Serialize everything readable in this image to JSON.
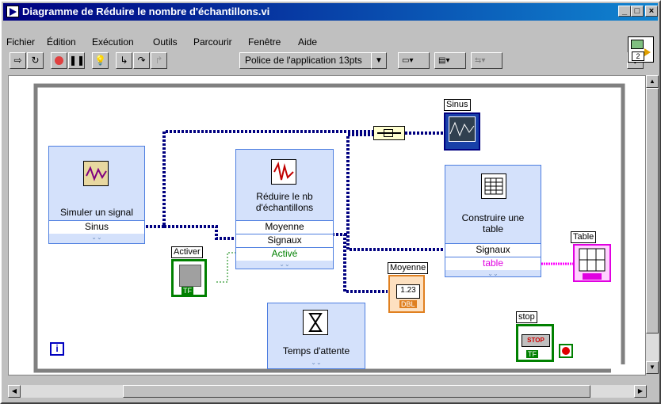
{
  "window": {
    "title": "Diagramme de Réduire le nombre d'échantillons.vi"
  },
  "menu": [
    "Fichier",
    "Édition",
    "Exécution",
    "Outils",
    "Parcourir",
    "Fenêtre",
    "Aide"
  ],
  "toolbar": {
    "font": "Police de l'application 13pts"
  },
  "vi_icon": {
    "number": "2"
  },
  "nodes": {
    "simulate": {
      "title": "Simuler un signal",
      "row1": "Sinus"
    },
    "reduce": {
      "title": "Réduire le nb\nd'échantillons",
      "row1": "Moyenne",
      "row2": "Signaux",
      "row3": "Activé"
    },
    "build_table": {
      "title": "Construire une\ntable",
      "row1": "Signaux",
      "row2": "table"
    },
    "wait": {
      "title": "Temps d'attente"
    }
  },
  "terminals": {
    "sinus_label": "Sinus",
    "activer_label": "Activer",
    "moyenne_label": "Moyenne",
    "moyenne_value": "1.23",
    "moyenne_type": "DBL",
    "table_label": "Table",
    "stop_label": "stop",
    "stop_text": "STOP",
    "tf": "TF",
    "info_icon": "i"
  },
  "colors": {
    "express_bg": "#d4e1fb",
    "express_border": "#4d7ee0",
    "dynamic_wire": "#000080",
    "string_wire": "#ff00ff",
    "bool_wire": "#008000",
    "loop_border": "#808080"
  }
}
